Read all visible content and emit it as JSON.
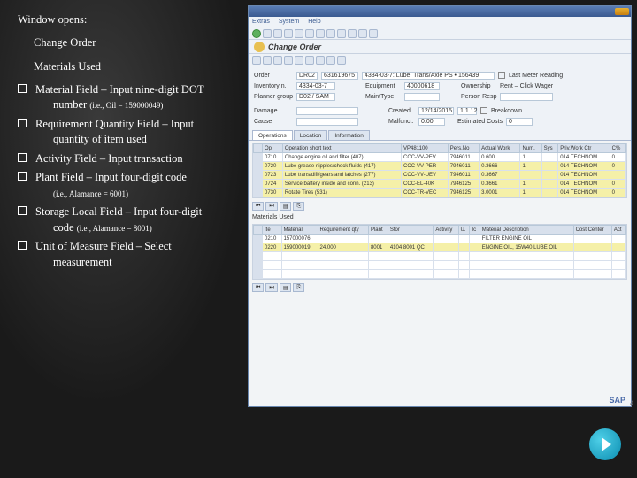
{
  "left": {
    "header": "Window opens:",
    "subtitle": "Change Order",
    "section": "Materials Used",
    "items": [
      {
        "main": "Material Field – Input nine-digit DOT",
        "cont": "number",
        "small": "(i.e., Oil = 159000049)"
      },
      {
        "main": "Requirement Quantity Field – Input",
        "cont": "quantity of item used",
        "small": ""
      },
      {
        "main": "Activity Field – Input transaction",
        "cont": "",
        "small": ""
      },
      {
        "main": "Plant Field – Input four-digit code",
        "cont": "",
        "small": "(i.e., Alamance = 6001)"
      },
      {
        "main": "Storage Local Field – Input four-digit",
        "cont": "code",
        "small": "(i.e., Alamance = 8001)"
      },
      {
        "main": "Unit of Measure Field – Select",
        "cont": "measurement",
        "small": ""
      }
    ]
  },
  "sap": {
    "title": "Change Order",
    "menu": [
      "Extras",
      "System",
      "Help"
    ],
    "hdr": {
      "order_lbl": "Order",
      "order_type": "DR02",
      "order_no": "631619675",
      "order_desc": "4334-03-7: Lube, Trans/Axle PS • 156439",
      "last_lbl": "Last Meter Reading",
      "inv_lbl": "Inventory n.",
      "inv": "4334-03-7",
      "eq_lbl": "Equipment",
      "eq": "40000618",
      "own_lbl": "Ownership",
      "own": "Rent – Click Wager",
      "pg_lbl": "Planner group",
      "pg": "D02 / SAM",
      "mt_lbl": "MaintType",
      "mt": "",
      "ps_lbl": "Person Resp",
      "dmg_lbl": "Damage",
      "crt_lbl": "Created",
      "crt_on": "12/14/2015",
      "crt_time": "1.1.12",
      "bd_lbl": "Breakdown",
      "cause_lbl": "Cause",
      "mal_lbl": "Malfunct.",
      "mal": "0.00",
      "est_lbl": "Estimated Costs",
      "est": "0"
    },
    "tabs": [
      "Operations",
      "Location",
      "Information"
    ],
    "ops_cols": [
      "Op",
      "Operation short text",
      "VP481100",
      "Pers.No",
      "Actual Work",
      "Num.",
      "Sys",
      "Priv.Work Ctr",
      "C%"
    ],
    "ops_rows": [
      {
        "op": "0710",
        "txt": "Change engine oil and filter (407)",
        "cc": "CCC-VV-PEV",
        "pn": "7946011",
        "aw": "0.600",
        "n": "1",
        "sy": "",
        "wc": "014 TECHNOM",
        "cp": "0"
      },
      {
        "op": "0720",
        "txt": "Lube grease nipples/check fluids (417)",
        "cc": "CCC-VV-PER",
        "pn": "7946011",
        "aw": "0.3666",
        "n": "1",
        "sy": "",
        "wc": "014 TECHNOM",
        "cp": "0"
      },
      {
        "op": "0723",
        "txt": "Lube trans/diff/gears and latches (277)",
        "cc": "CCC-VV-UEV",
        "pn": "7946011",
        "aw": "0.3667",
        "n": "",
        "sy": "",
        "wc": "014 TECHNOM",
        "cp": ""
      },
      {
        "op": "0724",
        "txt": "Service battery inside and conn. (213)",
        "cc": "CCC-EL-40K",
        "pn": "7946125",
        "aw": "0.3661",
        "n": "1",
        "sy": "",
        "wc": "014 TECHNOM",
        "cp": "0"
      },
      {
        "op": "0730",
        "txt": "Rotate Tires (531)",
        "cc": "CCC-TR-VEC",
        "pn": "7946125",
        "aw": "3.0001",
        "n": "1",
        "sy": "",
        "wc": "014 TECHNOM",
        "cp": "0"
      }
    ],
    "btns": [
      "⏮",
      "⏭",
      "▤",
      "⎘"
    ],
    "mat_title": "Materials Used",
    "mat_cols": [
      "Ite",
      "Material",
      "Requirement qty",
      "Plant",
      "Stor",
      "Activity",
      "U.",
      "Ic",
      "Material Description",
      "Cost Center",
      "Act"
    ],
    "mat_rows": [
      {
        "it": "0210",
        "mat": "157000076",
        "qty": "",
        "pl": "",
        "st": "",
        "ac": "",
        "u": "",
        "ic": "",
        "desc": "FILTER ENGINE OIL",
        "cc": "",
        "a2": ""
      },
      {
        "it": "0220",
        "mat": "159000019",
        "qty": "24.000",
        "pl": "8001",
        "st": "4104 8001 QC",
        "ac": "",
        "u": "",
        "ic": "",
        "desc": "ENGINE OIL, 15W40 LUBE OIL",
        "cc": "",
        "a2": ""
      },
      {
        "it": "",
        "mat": "",
        "qty": "",
        "pl": "",
        "st": "",
        "ac": "",
        "u": "",
        "ic": "",
        "desc": "",
        "cc": "",
        "a2": ""
      },
      {
        "it": "",
        "mat": "",
        "qty": "",
        "pl": "",
        "st": "",
        "ac": "",
        "u": "",
        "ic": "",
        "desc": "",
        "cc": "",
        "a2": ""
      },
      {
        "it": "",
        "mat": "",
        "qty": "",
        "pl": "",
        "st": "",
        "ac": "",
        "u": "",
        "ic": "",
        "desc": "",
        "cc": "",
        "a2": ""
      }
    ]
  },
  "slide_num": "4"
}
